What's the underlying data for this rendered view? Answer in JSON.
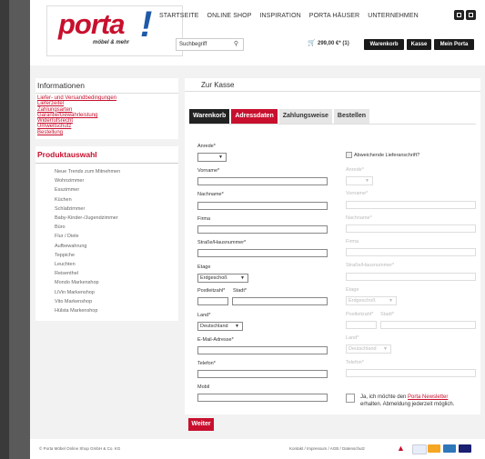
{
  "header": {
    "logo": {
      "word": "porta",
      "mark": "!",
      "tagline": "möbel & mehr"
    },
    "nav": [
      "STARTSEITE",
      "ONLINE SHOP",
      "INSPIRATION",
      "PORTA HÄUSER",
      "UNTERNEHMEN"
    ],
    "nav_icons": [
      "catalog-icon",
      "mail-icon"
    ],
    "search_placeholder": "Suchbegriff",
    "search_icon": "search-icon",
    "cart_icon": "basket-icon",
    "cart_total": "299,00 €* (1)",
    "buttons": {
      "cart": "Warenkorb",
      "checkout": "Kasse",
      "account": "Mein Porta"
    }
  },
  "sidebar": {
    "info_title": "Informationen",
    "info_links": [
      "Liefer- und Versandbedingungen",
      "Lieferzeitel",
      "Zahlungsarten",
      "Garantie/Gewährleistung",
      "Widerrufsrecht",
      "Umweltschutz",
      "Bestellung"
    ],
    "products_title": "Produktauswahl",
    "products": [
      "Neue Trends zum Mitnehmen",
      "Wohnzimmer",
      "Esszimmer",
      "Küchen",
      "Schlafzimmer",
      "Baby-Kinder-/Jugendzimmer",
      "Büro",
      "Flur / Diele",
      "Aufbewahrung",
      "Teppiche",
      "Leuchten",
      "Reisenthel",
      "Mondo Markenshop",
      "LiVin Markenshop",
      "Vito Markenshop",
      "Hülsta Markenshop"
    ]
  },
  "main": {
    "title": "Zur Kasse",
    "tabs": [
      "Warenkorb",
      "Adressdaten",
      "Zahlungsweise",
      "Bestellen"
    ],
    "left": {
      "anrede": "Anrede*",
      "vorname": "Vorname*",
      "nachname": "Nachname*",
      "firma": "Firma",
      "strasse": "Straße/Hausnummer*",
      "etage": "Etage",
      "etage_value": "Erdgeschoß",
      "plz": "Postleitzahl*",
      "stadt": "Stadt*",
      "land": "Land*",
      "land_value": "Deutschland",
      "email": "E-Mail-Adresse*",
      "telefon": "Telefon*",
      "mobil": "Mobil"
    },
    "right": {
      "abweichend": "Abweichende Lieferanschrift?",
      "anrede": "Anrede*",
      "vorname": "Vorname*",
      "nachname": "Nachname*",
      "firma": "Firma",
      "strasse": "Straße/Hausnummer*",
      "etage": "Etage",
      "etage_value": "Erdgeschoß",
      "plz": "Postleitzahl*",
      "stadt": "Stadt*",
      "land": "Land*",
      "land_value": "Deutschland",
      "telefon": "Telefon*"
    },
    "newsletter_pre": "Ja, ich möchte den ",
    "newsletter_link": "Porta Newsletter",
    "newsletter_post": "erhalten. Abmeldung jederzeit möglich.",
    "submit": "Weiter"
  },
  "footer": {
    "copyright": "© Porta Möbel Online Shop GmbH & Co. KG",
    "links": "Kontakt  /  Impressum  /  AGB  /  Datenschutz",
    "payments": [
      "sparkasse-icon",
      "paypal-icon",
      "mastercard-icon",
      "amex-icon",
      "visa-icon"
    ]
  },
  "colors": {
    "brand_red": "#c8102e",
    "brand_blue": "#1e5aa8",
    "dark": "#1a1a1a"
  }
}
